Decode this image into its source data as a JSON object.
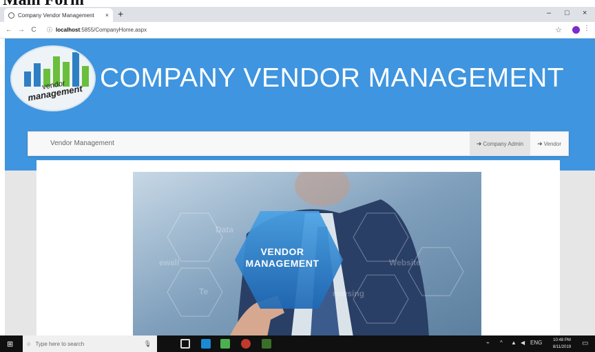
{
  "doc_heading": "Main Form",
  "browser": {
    "tab_title": "Company Vendor Management",
    "tab_close": "×",
    "new_tab": "+",
    "window_controls": [
      "–",
      "□",
      "×"
    ],
    "url_host": "localhost",
    "url_path": ":5855/CompanyHome.aspx",
    "nav": [
      "←",
      "→",
      "C"
    ],
    "star": "☆",
    "kebab": "⋮",
    "profile_color": "#7b2ccf"
  },
  "page": {
    "logo_text_line1": "vendor",
    "logo_text_line2": "management",
    "title": "COMPANY VENDOR MANAGEMENT",
    "banner_color": "#3f95df",
    "navbar": {
      "brand": "Vendor Management",
      "links": [
        {
          "label": "Company Admin",
          "icon": "login-icon"
        },
        {
          "label": "Vendor",
          "icon": "login-icon"
        }
      ]
    },
    "hero": {
      "hex_line1": "VENDOR",
      "hex_line2": "MANAGEMENT",
      "words": [
        "Data",
        "ewall",
        "Website",
        "Te",
        "rowsing"
      ]
    }
  },
  "taskbar": {
    "search_placeholder": "Type here to search",
    "time": "10:48 PM",
    "date": "8/11/2019",
    "lang": "ENG"
  }
}
